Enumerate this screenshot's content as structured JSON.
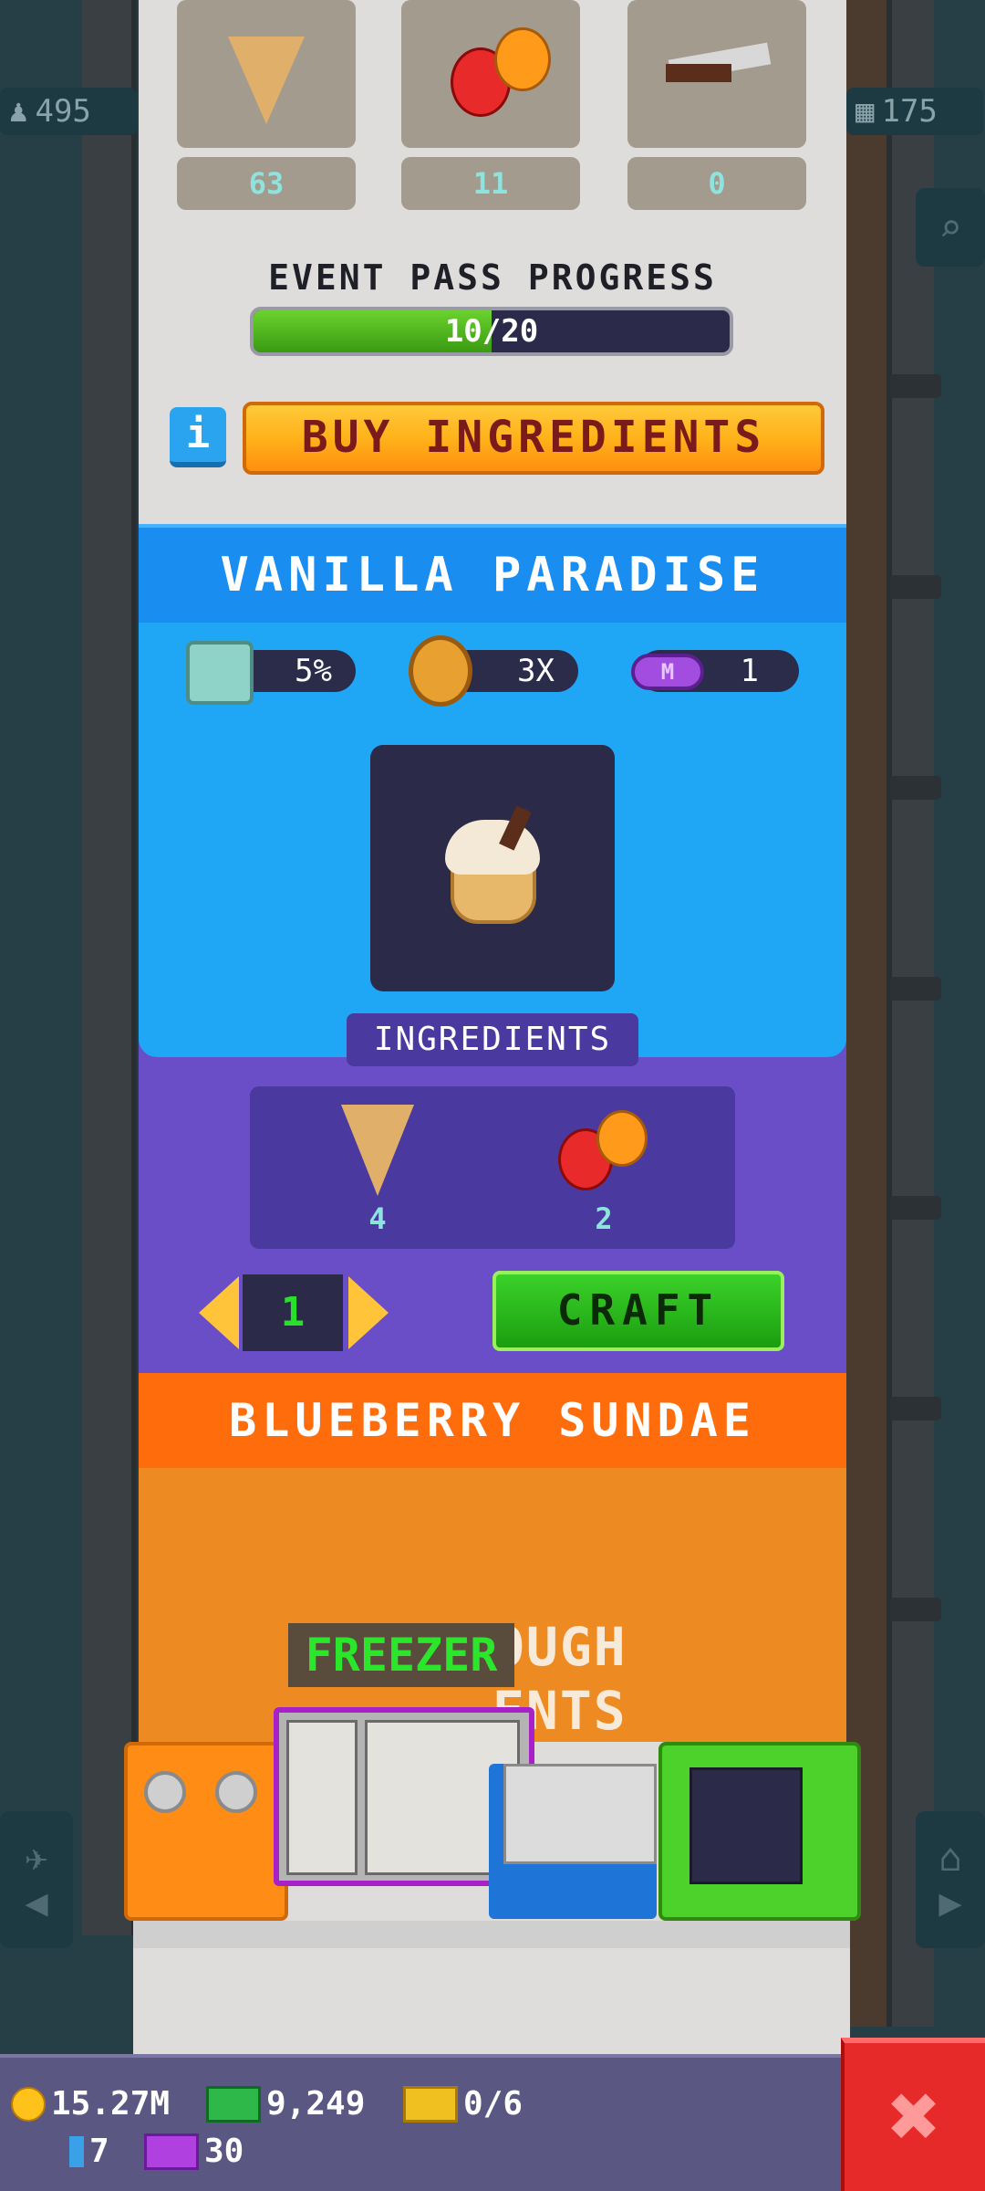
{
  "sidebar_left": {
    "population": "495"
  },
  "sidebar_right": {
    "floors": "175"
  },
  "inventory": {
    "items": [
      {
        "icon": "waffle-cone-icon",
        "count": "63"
      },
      {
        "icon": "berries-icon",
        "count": "11"
      },
      {
        "icon": "chocolate-icon",
        "count": "0"
      }
    ]
  },
  "event_pass": {
    "label": "EVENT PASS PROGRESS",
    "progress_text": "10/20",
    "progress": 0.5
  },
  "buy_ingredients": {
    "info_label": "i",
    "label": "BUY INGREDIENTS"
  },
  "recipe": {
    "title": "VANILLA PARADISE",
    "stats": {
      "fridge": "5%",
      "coins": "3X",
      "m_badge": "M",
      "m_value": "1"
    },
    "ingredients_label": "INGREDIENTS",
    "ingredients": [
      {
        "icon": "waffle-cone-icon",
        "count": "4"
      },
      {
        "icon": "berries-icon",
        "count": "2"
      }
    ],
    "quantity": "1",
    "craft_label": "CRAFT"
  },
  "next_recipe": {
    "title": "BLUEBERRY SUNDAE",
    "locked_line1": "OUGH",
    "locked_line2": "ENTS"
  },
  "machines": {
    "freezer_label": "FREEZER"
  },
  "status_bar": {
    "coins": "15.27M",
    "cash": "9,249",
    "tickets": "0/6",
    "gems": "7",
    "tokens": "30"
  },
  "close_label": "✖",
  "colors": {
    "recipe_header": "#1a8df0",
    "ingredients_panel": "#6a4ec8",
    "next_header": "#ff6c0c",
    "craft_button": "#1a9e10",
    "buy_button": "#ffb21a",
    "close_button": "#e62a2a"
  }
}
